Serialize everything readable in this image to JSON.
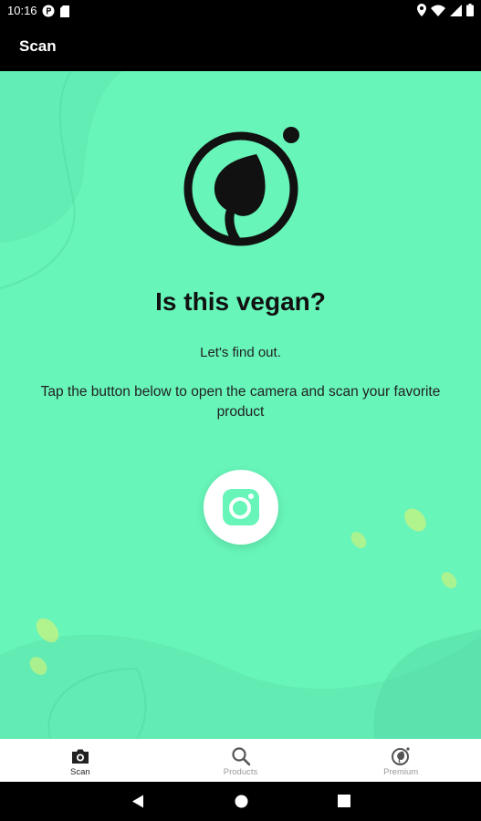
{
  "status_bar": {
    "time": "10:16",
    "left_icons": [
      "p-circle-icon",
      "sd-card-icon"
    ],
    "right_icons": [
      "location-icon",
      "wifi-icon",
      "signal-icon",
      "battery-icon"
    ]
  },
  "app_bar": {
    "title": "Scan"
  },
  "main": {
    "headline": "Is this vegan?",
    "subline": "Let's find out.",
    "instruction": "Tap the button below to open the camera and scan your favorite product",
    "camera_button_icon": "camera-icon"
  },
  "bottom_nav": {
    "items": [
      {
        "label": "Scan",
        "icon": "camera-icon",
        "active": true
      },
      {
        "label": "Products",
        "icon": "search-icon",
        "active": false
      },
      {
        "label": "Premium",
        "icon": "leaf-badge-icon",
        "active": false
      }
    ]
  },
  "system_nav": {
    "buttons": [
      "back-icon",
      "home-icon",
      "recents-icon"
    ]
  },
  "colors": {
    "background": "#67f5b9",
    "accent_dark": "#111111",
    "nav_inactive": "#999999"
  }
}
